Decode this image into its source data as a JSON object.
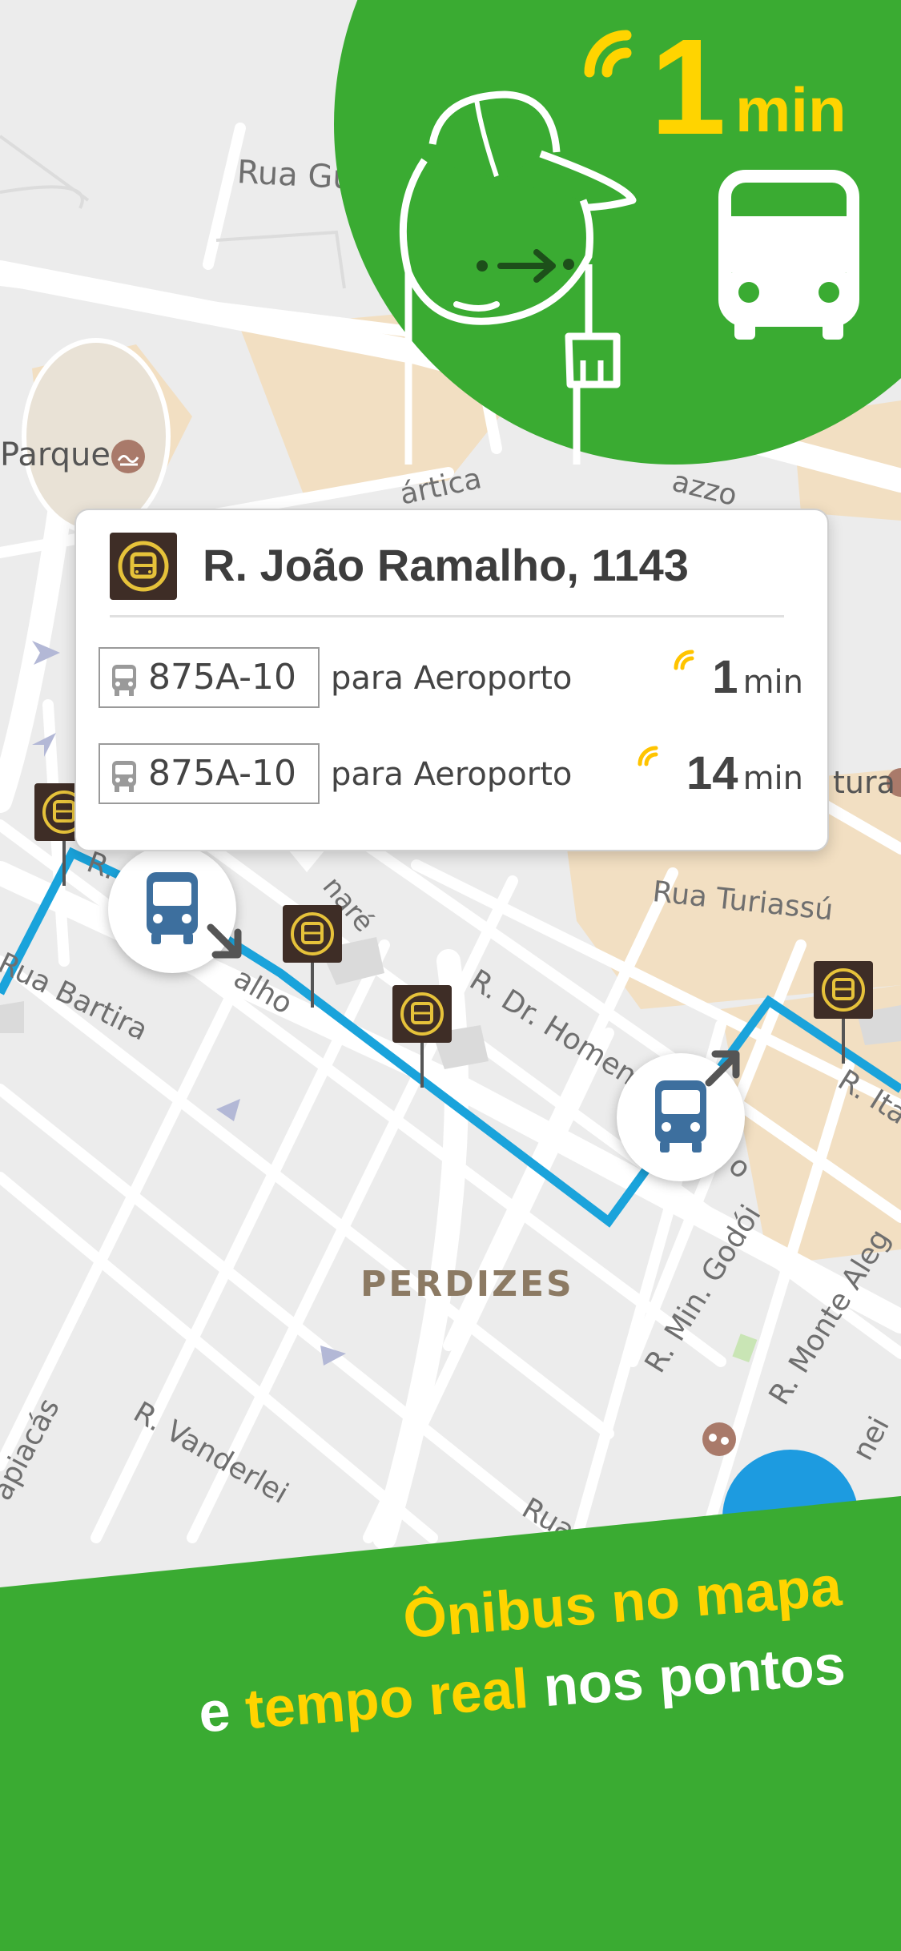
{
  "map": {
    "streets": [
      {
        "label": "Rua Gu"
      },
      {
        "label": "Parque"
      },
      {
        "label": "ártica"
      },
      {
        "label": "azzo"
      },
      {
        "label": "tura"
      },
      {
        "label": "Rua Turiassú"
      },
      {
        "label": "R. Dr. Homem"
      },
      {
        "label": "R. Ita"
      },
      {
        "label": "Rua Bartira"
      },
      {
        "label": "alho"
      },
      {
        "label": "naré"
      },
      {
        "label": "R. Min. Godói"
      },
      {
        "label": "R. Monte Aleg"
      },
      {
        "label": "R. Vanderlei"
      },
      {
        "label": "apiacás"
      },
      {
        "label": "Rua"
      },
      {
        "label": "o"
      },
      {
        "label": "R."
      },
      {
        "label": "nei"
      }
    ],
    "neighborhood": "PERDIZES",
    "route_color": "#1aa3db"
  },
  "realtime_badge": {
    "value": "1",
    "unit": "min",
    "color": "#ffd400",
    "background": "#3aab32"
  },
  "callout": {
    "stop_name": "R. João Ramalho, 1143",
    "arrivals": [
      {
        "route": "875A-10",
        "destination": "para Aeroporto",
        "eta": "1",
        "unit": "min"
      },
      {
        "route": "875A-10",
        "destination": "para Aeroporto",
        "eta": "14",
        "unit": "min"
      }
    ]
  },
  "tagline": {
    "line1": "Ônibus no mapa",
    "line2_a": "e ",
    "line2_b": "tempo real",
    "line2_c": " nos pontos"
  },
  "icons": [
    "bus-stop-icon",
    "bus-icon",
    "realtime-signal-icon",
    "mascot-illustration",
    "direction-arrow-icon",
    "park-icon",
    "theater-icon"
  ]
}
